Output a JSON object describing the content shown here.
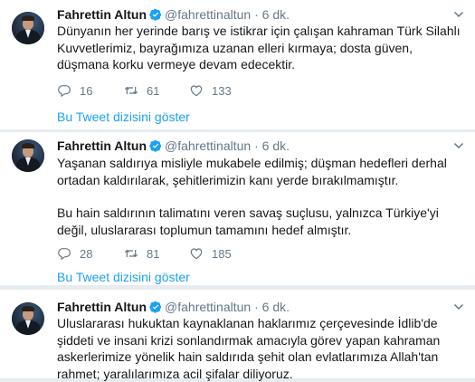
{
  "tweets": [
    {
      "name": "Fahrettin Altun",
      "handle": "@fahrettinaltun",
      "dot": "·",
      "time": "6 dk.",
      "paragraphs": [
        "Dünyanın her yerinde barış ve istikrar için çalışan kahraman Türk Silahlı Kuvvetlerimiz, bayrağımıza uzanan elleri kırmaya; dosta güven, düşmana korku vermeye devam edecektir."
      ],
      "replies": "16",
      "retweets": "61",
      "likes": "133",
      "show_thread": "Bu Tweet dizisini göster"
    },
    {
      "name": "Fahrettin Altun",
      "handle": "@fahrettinaltun",
      "dot": "·",
      "time": "6 dk.",
      "paragraphs": [
        "Yaşanan saldırıya misliyle mukabele edilmiş; düşman hedefleri derhal ortadan kaldırılarak, şehitlerimizin kanı yerde bırakılmamıştır.",
        "Bu hain saldırının talimatını veren savaş suçlusu, yalnızca Türkiye'yi değil, uluslararası toplumun tamamını hedef almıştır."
      ],
      "replies": "28",
      "retweets": "81",
      "likes": "185",
      "show_thread": "Bu Tweet dizisini göster"
    },
    {
      "name": "Fahrettin Altun",
      "handle": "@fahrettinaltun",
      "dot": "·",
      "time": "6 dk.",
      "paragraphs": [
        "Uluslararası hukuktan kaynaklanan haklarımız çerçevesinde İdlib'de şiddeti ve insani krizi sonlandırmak amacıyla görev yapan kahraman askerlerimize yönelik hain saldırıda şehit olan evlatlarımıza Allah'tan rahmet; yaralılarımıza acil şifalar diliyoruz."
      ]
    }
  ],
  "colors": {
    "link": "#1da1f2",
    "muted": "#657786",
    "text": "#14171a",
    "verified": "#1da1f2"
  },
  "icons": [
    "reply-icon",
    "retweet-icon",
    "like-icon",
    "verified-badge-icon",
    "caret-down-icon"
  ]
}
